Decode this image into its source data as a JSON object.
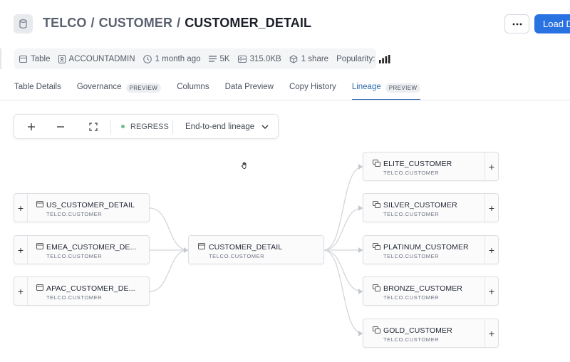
{
  "header": {
    "crumbs": [
      "TELCO",
      "CUSTOMER"
    ],
    "separator": "/",
    "current": "CUSTOMER_DETAIL",
    "more_label": "···",
    "load_label": "Load D"
  },
  "meta": {
    "type": "Table",
    "owner": "ACCOUNTADMIN",
    "updated": "1 month ago",
    "rows": "5K",
    "size": "315.0KB",
    "shares": "1 share",
    "popularity_label": "Popularity:"
  },
  "tabs": [
    {
      "label": "Table Details",
      "badge": ""
    },
    {
      "label": "Governance",
      "badge": "PREVIEW"
    },
    {
      "label": "Columns",
      "badge": ""
    },
    {
      "label": "Data Preview",
      "badge": ""
    },
    {
      "label": "Copy History",
      "badge": ""
    },
    {
      "label": "Lineage",
      "badge": "PREVIEW",
      "active": true
    }
  ],
  "toolbar": {
    "zoom_in": "+",
    "zoom_out": "−",
    "warehouse": "REGRESS",
    "lineage_mode": "End-to-end lineage"
  },
  "nodes": {
    "upstream": [
      {
        "name": "US_CUSTOMER_DETAIL",
        "path": "TELCO.CUSTOMER"
      },
      {
        "name": "EMEA_CUSTOMER_DE...",
        "path": "TELCO.CUSTOMER"
      },
      {
        "name": "APAC_CUSTOMER_DE...",
        "path": "TELCO.CUSTOMER"
      }
    ],
    "center": {
      "name": "CUSTOMER_DETAIL",
      "path": "TELCO.CUSTOMER"
    },
    "downstream": [
      {
        "name": "ELITE_CUSTOMER",
        "path": "TELCO.CUSTOMER"
      },
      {
        "name": "SILVER_CUSTOMER",
        "path": "TELCO.CUSTOMER"
      },
      {
        "name": "PLATINUM_CUSTOMER",
        "path": "TELCO.CUSTOMER"
      },
      {
        "name": "BRONZE_CUSTOMER",
        "path": "TELCO.CUSTOMER"
      },
      {
        "name": "GOLD_CUSTOMER",
        "path": "TELCO.CUSTOMER"
      }
    ],
    "expand_label": "+"
  },
  "colors": {
    "accent": "#2972e2",
    "active_tab": "#2f6ab0",
    "status_dot": "#6bc08a"
  }
}
